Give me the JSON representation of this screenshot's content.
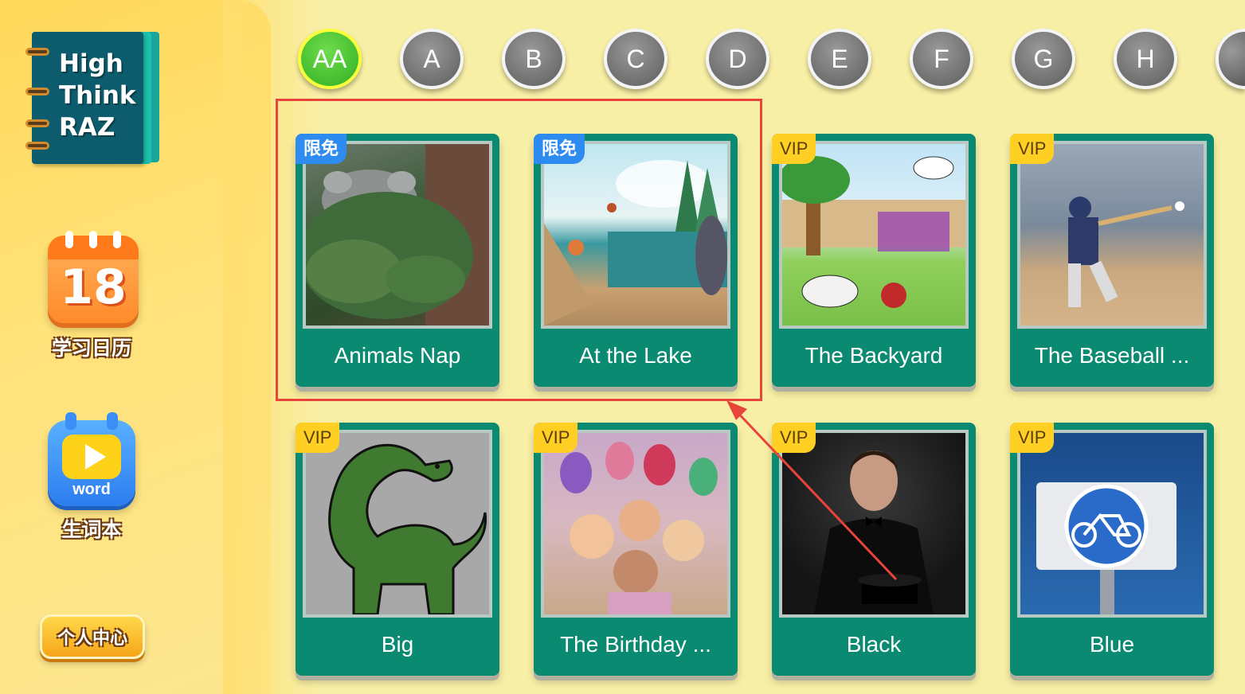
{
  "app": {
    "logo_lines": [
      "High",
      "Think",
      "RAZ"
    ]
  },
  "sidebar": {
    "calendar_day": "18",
    "calendar_label": "学习日历",
    "word_icon_text": "word",
    "word_label": "生词本",
    "personal_center": "个人中心"
  },
  "levels": [
    "AA",
    "A",
    "B",
    "C",
    "D",
    "E",
    "F",
    "G",
    "H",
    ""
  ],
  "active_level": "AA",
  "books": [
    {
      "title": "Animals Nap",
      "badge": "限免",
      "badge_type": "free"
    },
    {
      "title": "At the Lake",
      "badge": "限免",
      "badge_type": "free"
    },
    {
      "title": "The Backyard",
      "badge": "VIP",
      "badge_type": "vip"
    },
    {
      "title": "The Baseball ...",
      "badge": "VIP",
      "badge_type": "vip"
    },
    {
      "title": "Big",
      "badge": "VIP",
      "badge_type": "vip"
    },
    {
      "title": "The Birthday ...",
      "badge": "VIP",
      "badge_type": "vip"
    },
    {
      "title": "Black",
      "badge": "VIP",
      "badge_type": "vip"
    },
    {
      "title": "Blue",
      "badge": "VIP",
      "badge_type": "vip"
    }
  ],
  "colors": {
    "card_green": "#0a8a70",
    "free_badge": "#2e8bf0",
    "vip_badge": "#ffcf24",
    "active_level": "#3cb82a",
    "annotation_red": "#e8443a"
  }
}
